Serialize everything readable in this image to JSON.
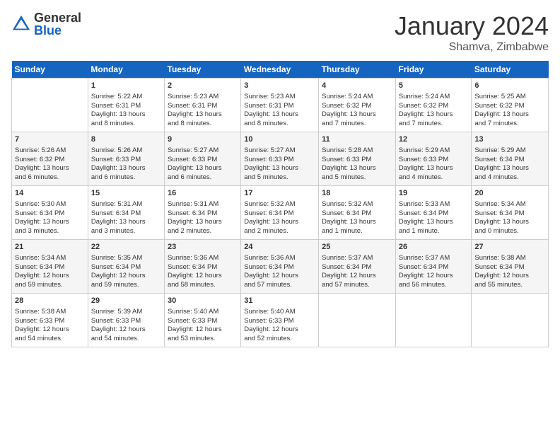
{
  "logo": {
    "general": "General",
    "blue": "Blue"
  },
  "title": "January 2024",
  "subtitle": "Shamva, Zimbabwe",
  "days_header": [
    "Sunday",
    "Monday",
    "Tuesday",
    "Wednesday",
    "Thursday",
    "Friday",
    "Saturday"
  ],
  "weeks": [
    [
      {
        "num": "",
        "lines": []
      },
      {
        "num": "1",
        "lines": [
          "Sunrise: 5:22 AM",
          "Sunset: 6:31 PM",
          "Daylight: 13 hours",
          "and 8 minutes."
        ]
      },
      {
        "num": "2",
        "lines": [
          "Sunrise: 5:23 AM",
          "Sunset: 6:31 PM",
          "Daylight: 13 hours",
          "and 8 minutes."
        ]
      },
      {
        "num": "3",
        "lines": [
          "Sunrise: 5:23 AM",
          "Sunset: 6:31 PM",
          "Daylight: 13 hours",
          "and 8 minutes."
        ]
      },
      {
        "num": "4",
        "lines": [
          "Sunrise: 5:24 AM",
          "Sunset: 6:32 PM",
          "Daylight: 13 hours",
          "and 7 minutes."
        ]
      },
      {
        "num": "5",
        "lines": [
          "Sunrise: 5:24 AM",
          "Sunset: 6:32 PM",
          "Daylight: 13 hours",
          "and 7 minutes."
        ]
      },
      {
        "num": "6",
        "lines": [
          "Sunrise: 5:25 AM",
          "Sunset: 6:32 PM",
          "Daylight: 13 hours",
          "and 7 minutes."
        ]
      }
    ],
    [
      {
        "num": "7",
        "lines": [
          "Sunrise: 5:26 AM",
          "Sunset: 6:32 PM",
          "Daylight: 13 hours",
          "and 6 minutes."
        ]
      },
      {
        "num": "8",
        "lines": [
          "Sunrise: 5:26 AM",
          "Sunset: 6:33 PM",
          "Daylight: 13 hours",
          "and 6 minutes."
        ]
      },
      {
        "num": "9",
        "lines": [
          "Sunrise: 5:27 AM",
          "Sunset: 6:33 PM",
          "Daylight: 13 hours",
          "and 6 minutes."
        ]
      },
      {
        "num": "10",
        "lines": [
          "Sunrise: 5:27 AM",
          "Sunset: 6:33 PM",
          "Daylight: 13 hours",
          "and 5 minutes."
        ]
      },
      {
        "num": "11",
        "lines": [
          "Sunrise: 5:28 AM",
          "Sunset: 6:33 PM",
          "Daylight: 13 hours",
          "and 5 minutes."
        ]
      },
      {
        "num": "12",
        "lines": [
          "Sunrise: 5:29 AM",
          "Sunset: 6:33 PM",
          "Daylight: 13 hours",
          "and 4 minutes."
        ]
      },
      {
        "num": "13",
        "lines": [
          "Sunrise: 5:29 AM",
          "Sunset: 6:34 PM",
          "Daylight: 13 hours",
          "and 4 minutes."
        ]
      }
    ],
    [
      {
        "num": "14",
        "lines": [
          "Sunrise: 5:30 AM",
          "Sunset: 6:34 PM",
          "Daylight: 13 hours",
          "and 3 minutes."
        ]
      },
      {
        "num": "15",
        "lines": [
          "Sunrise: 5:31 AM",
          "Sunset: 6:34 PM",
          "Daylight: 13 hours",
          "and 3 minutes."
        ]
      },
      {
        "num": "16",
        "lines": [
          "Sunrise: 5:31 AM",
          "Sunset: 6:34 PM",
          "Daylight: 13 hours",
          "and 2 minutes."
        ]
      },
      {
        "num": "17",
        "lines": [
          "Sunrise: 5:32 AM",
          "Sunset: 6:34 PM",
          "Daylight: 13 hours",
          "and 2 minutes."
        ]
      },
      {
        "num": "18",
        "lines": [
          "Sunrise: 5:32 AM",
          "Sunset: 6:34 PM",
          "Daylight: 13 hours",
          "and 1 minute."
        ]
      },
      {
        "num": "19",
        "lines": [
          "Sunrise: 5:33 AM",
          "Sunset: 6:34 PM",
          "Daylight: 13 hours",
          "and 1 minute."
        ]
      },
      {
        "num": "20",
        "lines": [
          "Sunrise: 5:34 AM",
          "Sunset: 6:34 PM",
          "Daylight: 13 hours",
          "and 0 minutes."
        ]
      }
    ],
    [
      {
        "num": "21",
        "lines": [
          "Sunrise: 5:34 AM",
          "Sunset: 6:34 PM",
          "Daylight: 12 hours",
          "and 59 minutes."
        ]
      },
      {
        "num": "22",
        "lines": [
          "Sunrise: 5:35 AM",
          "Sunset: 6:34 PM",
          "Daylight: 12 hours",
          "and 59 minutes."
        ]
      },
      {
        "num": "23",
        "lines": [
          "Sunrise: 5:36 AM",
          "Sunset: 6:34 PM",
          "Daylight: 12 hours",
          "and 58 minutes."
        ]
      },
      {
        "num": "24",
        "lines": [
          "Sunrise: 5:36 AM",
          "Sunset: 6:34 PM",
          "Daylight: 12 hours",
          "and 57 minutes."
        ]
      },
      {
        "num": "25",
        "lines": [
          "Sunrise: 5:37 AM",
          "Sunset: 6:34 PM",
          "Daylight: 12 hours",
          "and 57 minutes."
        ]
      },
      {
        "num": "26",
        "lines": [
          "Sunrise: 5:37 AM",
          "Sunset: 6:34 PM",
          "Daylight: 12 hours",
          "and 56 minutes."
        ]
      },
      {
        "num": "27",
        "lines": [
          "Sunrise: 5:38 AM",
          "Sunset: 6:34 PM",
          "Daylight: 12 hours",
          "and 55 minutes."
        ]
      }
    ],
    [
      {
        "num": "28",
        "lines": [
          "Sunrise: 5:38 AM",
          "Sunset: 6:33 PM",
          "Daylight: 12 hours",
          "and 54 minutes."
        ]
      },
      {
        "num": "29",
        "lines": [
          "Sunrise: 5:39 AM",
          "Sunset: 6:33 PM",
          "Daylight: 12 hours",
          "and 54 minutes."
        ]
      },
      {
        "num": "30",
        "lines": [
          "Sunrise: 5:40 AM",
          "Sunset: 6:33 PM",
          "Daylight: 12 hours",
          "and 53 minutes."
        ]
      },
      {
        "num": "31",
        "lines": [
          "Sunrise: 5:40 AM",
          "Sunset: 6:33 PM",
          "Daylight: 12 hours",
          "and 52 minutes."
        ]
      },
      {
        "num": "",
        "lines": []
      },
      {
        "num": "",
        "lines": []
      },
      {
        "num": "",
        "lines": []
      }
    ]
  ]
}
